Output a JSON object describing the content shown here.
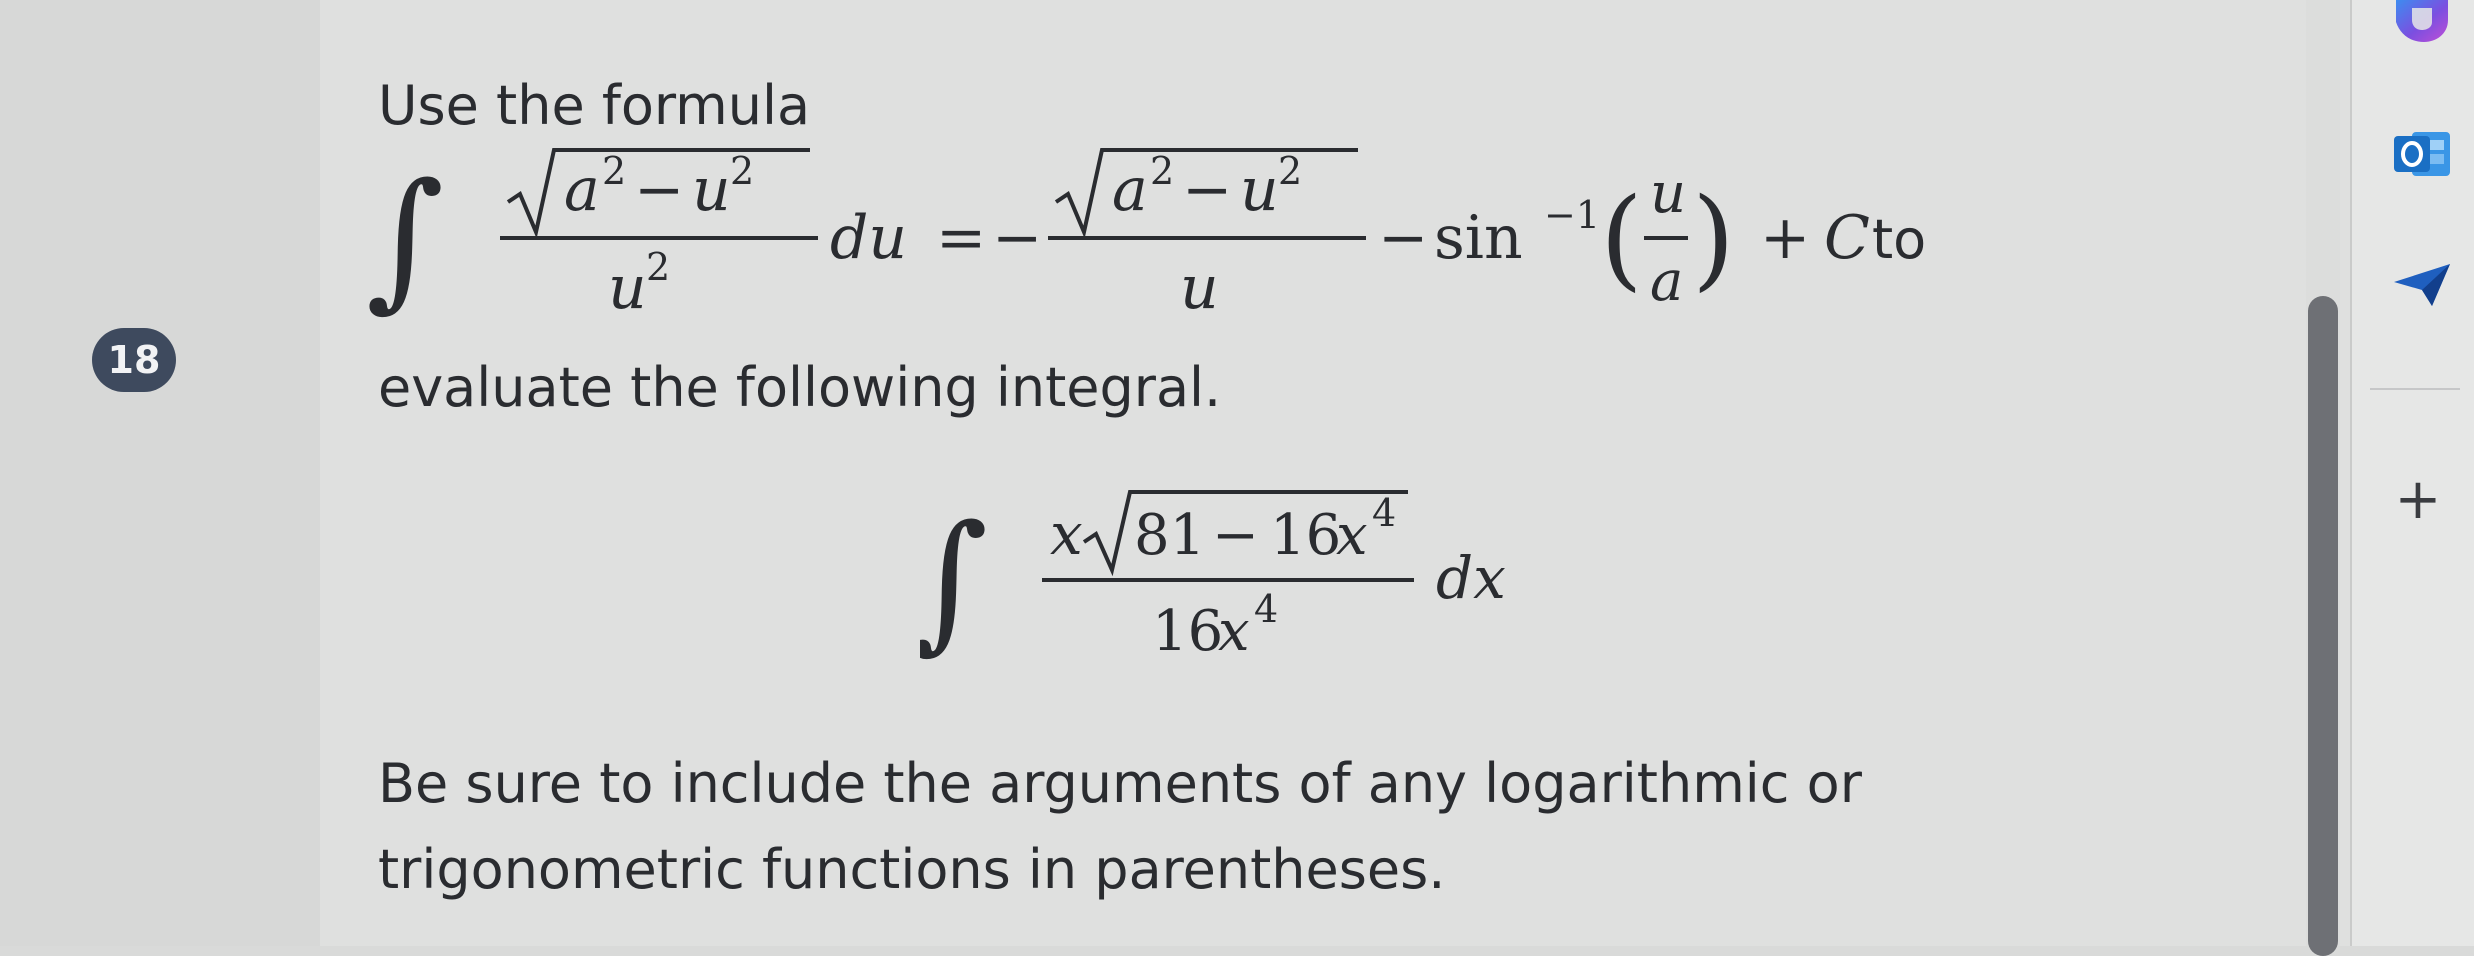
{
  "question": {
    "number": "18",
    "intro": "Use the formula",
    "formula": {
      "integrand_numerator": "√(a² − u²)",
      "integrand_denominator": "u²",
      "rhs": "−√(a² − u²)/u − sin⁻¹(u/a) + C",
      "trailing_text": "to"
    },
    "instruction": "evaluate the following integral.",
    "integral": {
      "numerator": "x√(81 − 16x⁴)",
      "denominator": "16x⁴",
      "differential": "dx"
    },
    "note_line_1": "Be sure to include the arguments of any logarithmic or",
    "note_line_2": "trigonometric functions in parentheses."
  },
  "rail": {
    "icons": [
      "copilot-icon",
      "outlook-icon",
      "send-icon"
    ],
    "add_label": "+"
  },
  "colors": {
    "badge": "#3e4a5e",
    "text": "#2a2c30",
    "outlook_blue": "#1a6fc4",
    "send_blue": "#1f5fbf"
  }
}
